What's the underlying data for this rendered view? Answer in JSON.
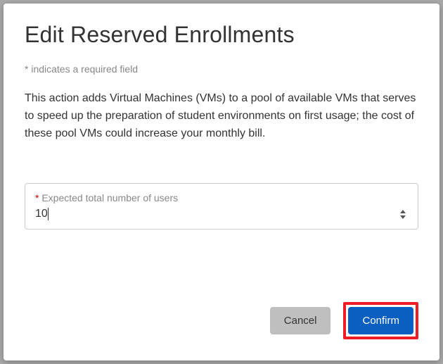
{
  "title": "Edit Reserved Enrollments",
  "requiredNote": "* indicates a required field",
  "description": "This action adds Virtual Machines (VMs) to a pool of available VMs that serves to speed up the preparation of student environments on first usage; the cost of these pool VMs could increase your monthly bill.",
  "field": {
    "asterisk": "*",
    "label": " Expected total number of users",
    "value": "10"
  },
  "buttons": {
    "cancel": "Cancel",
    "confirm": "Confirm"
  }
}
